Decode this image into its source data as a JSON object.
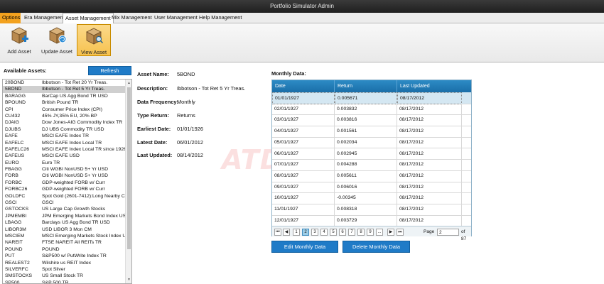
{
  "window": {
    "title": "Portfolio Simulator Admin"
  },
  "menu": {
    "options": "Options",
    "tabs": [
      "Era Management",
      "Asset Management",
      "Mix Management",
      "User Management",
      "Help Management"
    ],
    "active": "Asset Management"
  },
  "ribbon": {
    "buttons": [
      {
        "label": "Add Asset",
        "icon": "box-add-icon"
      },
      {
        "label": "Update Asset",
        "icon": "box-update-icon"
      },
      {
        "label": "View Asset",
        "icon": "box-view-icon"
      }
    ],
    "active": "View Asset"
  },
  "assets": {
    "title": "Available Assets:",
    "refresh_label": "Refresh",
    "items": [
      {
        "code": "20BOND",
        "name": "Ibbotson - Tot Ret 20 Yr Treas."
      },
      {
        "code": "5BOND",
        "name": "Ibbotson - Tot Ret 5 Yr Treas."
      },
      {
        "code": "BARAGG",
        "name": "BarCap US Agg Bond TR USD"
      },
      {
        "code": "BPOUND",
        "name": "British Pound TR"
      },
      {
        "code": "CPI",
        "name": "Consumer Price Index (CPI)"
      },
      {
        "code": "CU432",
        "name": "45% JY,35% EU, 20% BP"
      },
      {
        "code": "DJAIG",
        "name": "Dow Jones-AIG Commodity Index TR"
      },
      {
        "code": "DJUBS",
        "name": "DJ UBS Commodity TR USD"
      },
      {
        "code": "EAFE",
        "name": "MSCI EAFE Index TR"
      },
      {
        "code": "EAFELC",
        "name": "MSCI EAFE Index Local TR"
      },
      {
        "code": "EAFELC26",
        "name": "MSCI EAFE Index Local TR since 1926"
      },
      {
        "code": "EAFEUS",
        "name": "MSCI EAFE USD"
      },
      {
        "code": "EURO",
        "name": "Euro TR"
      },
      {
        "code": "FBAGG",
        "name": "Citi WGBI NonUSD 5+ Yr USD"
      },
      {
        "code": "FORB",
        "name": "Citi WGBI NonUSD 5+ Yr USD"
      },
      {
        "code": "FORBC",
        "name": "GDP-weighted FORB w/ Curr"
      },
      {
        "code": "FORBC26",
        "name": "GDP-weighted FORB w/ Curr"
      },
      {
        "code": "GOLDFC",
        "name": "Spot Gold (2601-7412):Long Nearby C"
      },
      {
        "code": "GSCI",
        "name": "GSCI"
      },
      {
        "code": "GSTOCKS",
        "name": "US Large Cap Growth Stocks"
      },
      {
        "code": "JPMEMBI",
        "name": "JPM Emerging Markets Bond Index USE"
      },
      {
        "code": "LBAGG",
        "name": "Barclays US Agg Bond TR USD"
      },
      {
        "code": "LIBOR3M",
        "name": "USD LIBOR 3 Mon CM"
      },
      {
        "code": "MSCIEM",
        "name": "MSCI Emerging Markets Stock Index U"
      },
      {
        "code": "NAREIT",
        "name": "FTSE NAREIT All REITs TR"
      },
      {
        "code": "POUND",
        "name": "POUND"
      },
      {
        "code": "PUT",
        "name": "S&P500 w/ PutWrite Index TR"
      },
      {
        "code": "REALEST2",
        "name": "Wilshire us REIT Index"
      },
      {
        "code": "SILVERFC",
        "name": "Spot Silver"
      },
      {
        "code": "SMSTOCKS",
        "name": "US Small Stock TR"
      },
      {
        "code": "SP500",
        "name": "S&P 500 TR"
      }
    ],
    "selected_index": 1
  },
  "details": [
    {
      "label": "Asset Name:",
      "value": "5BOND"
    },
    {
      "label": "Description:",
      "value": "Ibbotson - Tot Ret 5 Yr Treas."
    },
    {
      "label": "Data Frequency:",
      "value": "Monthly"
    },
    {
      "label": "Type Return:",
      "value": "Returns"
    },
    {
      "label": "Earliest Date:",
      "value": "01/01/1926"
    },
    {
      "label": "Latest Date:",
      "value": "06/01/2012"
    },
    {
      "label": "Last Updated:",
      "value": "08/14/2012"
    }
  ],
  "watermark": "ATDRIVE",
  "monthly": {
    "title": "Monthly Data:",
    "columns": [
      "Date",
      "Return",
      "Last Updated"
    ],
    "rows": [
      [
        "01/01/1927",
        "0.005671",
        "08/17/2012"
      ],
      [
        "02/01/1927",
        "0.003832",
        "08/17/2012"
      ],
      [
        "03/01/1927",
        "0.003816",
        "08/17/2012"
      ],
      [
        "04/01/1927",
        "0.001561",
        "08/17/2012"
      ],
      [
        "05/01/1927",
        "0.002034",
        "08/17/2012"
      ],
      [
        "06/01/1927",
        "0.002945",
        "08/17/2012"
      ],
      [
        "07/01/1927",
        "0.004288",
        "08/17/2012"
      ],
      [
        "08/01/1927",
        "0.005611",
        "08/17/2012"
      ],
      [
        "09/01/1927",
        "0.006016",
        "08/17/2012"
      ],
      [
        "10/01/1927",
        "-0.00345",
        "08/17/2012"
      ],
      [
        "11/01/1927",
        "0.008318",
        "08/17/2012"
      ],
      [
        "12/01/1927",
        "0.003729",
        "08/17/2012"
      ]
    ],
    "selected_index": 0,
    "pager": {
      "first": "⏮",
      "prev": "◀",
      "pages": [
        "1",
        "2",
        "3",
        "4",
        "5",
        "6",
        "7",
        "8",
        "9",
        "..."
      ],
      "active_page": "2",
      "next": "▶",
      "last": "⏭",
      "page_label": "Page",
      "page_value": "2",
      "of_label": "of 87"
    },
    "edit_label": "Edit Monthly Data",
    "delete_label": "Delete Monthly Data"
  }
}
